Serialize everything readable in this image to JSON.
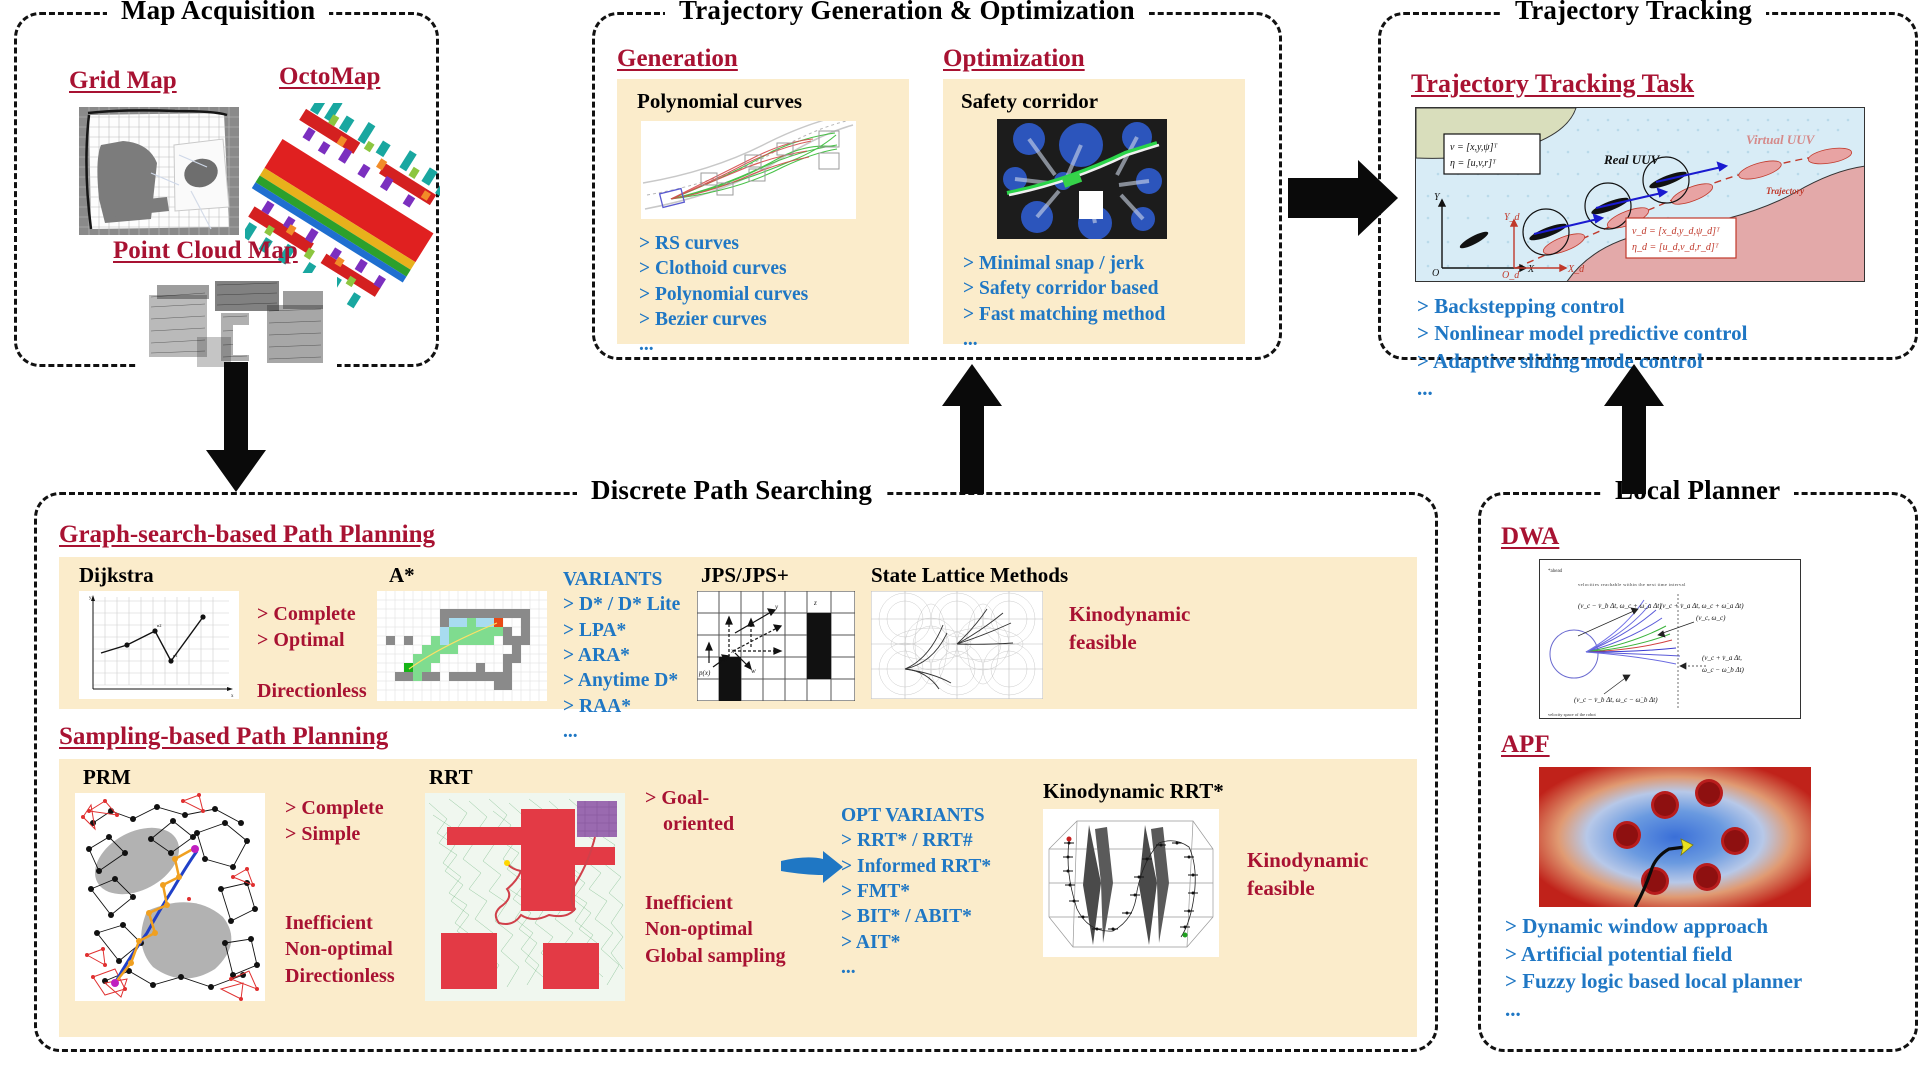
{
  "panels": {
    "map_acquisition": {
      "title": "Map Acquisition",
      "items": [
        {
          "label": "Grid Map",
          "figure": "grid-map-figure"
        },
        {
          "label": "OctoMap",
          "figure": "octomap-figure"
        },
        {
          "label": "Point Cloud Map",
          "figure": "point-cloud-map-figure"
        }
      ]
    },
    "trajectory_generation": {
      "title": "Trajectory Generation & Optimization",
      "columns": [
        {
          "heading": "Generation",
          "subheading": "Polynomial curves",
          "figure": "polynomial-curves-figure",
          "bullets": [
            "> RS curves",
            "> Clothoid curves",
            "> Polynomial curves",
            "> Bezier curves",
            "..."
          ]
        },
        {
          "heading": "Optimization",
          "subheading": "Safety corridor",
          "figure": "safety-corridor-figure",
          "bullets": [
            "> Minimal snap / jerk",
            "> Safety corridor based",
            "> Fast matching method",
            "..."
          ]
        }
      ]
    },
    "trajectory_tracking": {
      "title": "Trajectory Tracking",
      "heading": "Trajectory Tracking Task",
      "figure": "uuv-tracking-figure",
      "figure_labels": {
        "real_uuv": "Real UUV",
        "virtual_uuv": "Virtual UUV",
        "trajectory": "Trajectory",
        "state_eq1": "v = [x,y,ψ]",
        "state_eq2": "η = [u,v,r]",
        "desired_eq1": "vₓ = [xₔ,yₔ,ψₔ]",
        "desired_eq2": "ηₔ = [uₔ,vₔ,rₔ]",
        "axis_X": "X",
        "axis_Y": "Y",
        "axis_O": "O",
        "axis_Xd": "Xₔ",
        "axis_Yd": "Yₔ",
        "axis_Od": "Oₔ"
      },
      "bullets": [
        "> Backstepping control",
        "> Nonlinear model predictive control",
        "> Adaptive sliding mode control",
        "..."
      ]
    },
    "discrete_path_searching": {
      "title": "Discrete Path Searching",
      "graph_section": {
        "heading": "Graph-search-based Path Planning",
        "blocks": [
          {
            "name": "Dijkstra",
            "figure": "dijkstra-figure",
            "notes": [
              "> Complete",
              "> Optimal",
              "",
              "Directionless"
            ]
          },
          {
            "name": "A*",
            "figure": "astar-figure"
          },
          {
            "name": "JPS/JPS+",
            "figure": "jps-figure"
          },
          {
            "name": "State Lattice Methods",
            "figure": "state-lattice-figure",
            "notes": [
              "Kinodynamic",
              "feasible"
            ]
          }
        ],
        "variants": {
          "header": "VARIANTS",
          "items": [
            "> D* / D* Lite",
            "> LPA*",
            "> ARA*",
            "> Anytime D*",
            "> RAA*",
            "..."
          ]
        }
      },
      "sampling_section": {
        "heading": "Sampling-based Path Planning",
        "blocks": [
          {
            "name": "PRM",
            "figure": "prm-figure",
            "notes": [
              "> Complete",
              "> Simple",
              "",
              "Inefficient",
              "Non-optimal",
              "Directionless"
            ]
          },
          {
            "name": "RRT",
            "figure": "rrt-figure",
            "notes": [
              "> Goal-",
              "  oriented",
              "",
              "Inefficient",
              "Non-optimal",
              "Global sampling"
            ]
          },
          {
            "name": "Kinodynamic RRT*",
            "figure": "kinodynamic-rrt-figure",
            "notes": [
              "Kinodynamic",
              "feasible"
            ]
          }
        ],
        "opt_variants": {
          "header": "OPT VARIANTS",
          "items": [
            "> RRT* / RRT#",
            "> Informed RRT*",
            "> FMT*",
            "> BIT* / ABIT*",
            "> AIT*",
            "..."
          ]
        }
      }
    },
    "local_planner": {
      "title": "Local Planner",
      "items": [
        {
          "label": "DWA",
          "figure": "dwa-figure"
        },
        {
          "label": "APF",
          "figure": "apf-figure"
        }
      ],
      "bullets": [
        "> Dynamic window approach",
        "> Artificial potential field",
        "> Fuzzy logic based local planner",
        "..."
      ]
    }
  },
  "colors": {
    "red_heading": "#a81232",
    "blue_list": "#1f77c4",
    "cream_panel": "#fbeccb",
    "border": "#111111"
  },
  "arrows": [
    {
      "name": "arrow-map-to-discrete",
      "direction": "down"
    },
    {
      "name": "arrow-discrete-to-generation",
      "direction": "up"
    },
    {
      "name": "arrow-optimization-to-tracking",
      "direction": "right"
    },
    {
      "name": "arrow-localplanner-to-tracking",
      "direction": "up"
    }
  ]
}
